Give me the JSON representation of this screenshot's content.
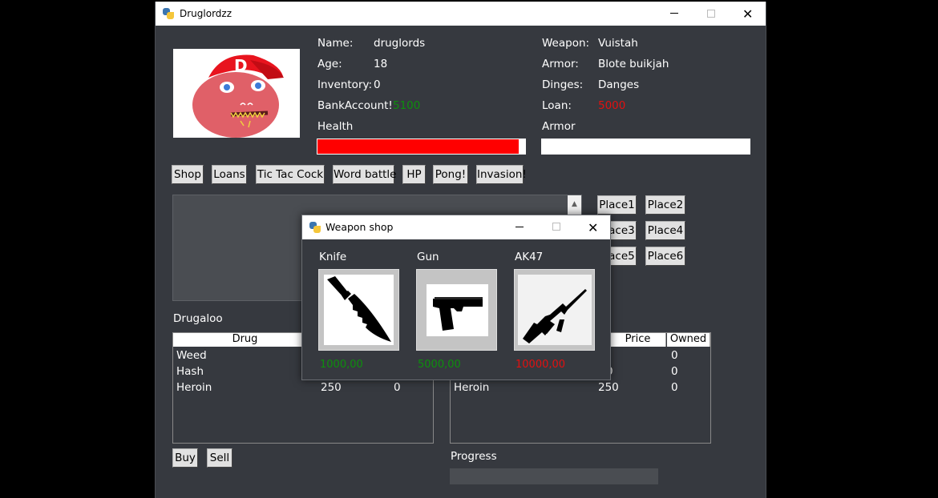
{
  "window": {
    "title": "Druglordzz"
  },
  "player": {
    "name_label": "Name:",
    "name": "druglords",
    "age_label": "Age:",
    "age": "18",
    "inventory_label": "Inventory:",
    "inventory": "0",
    "bank_label": "BankAccount!",
    "bank": "5100",
    "health_label": "Health",
    "health_fraction": 0.97
  },
  "equipment": {
    "weapon_label": "Weapon:",
    "weapon": "Vuistah",
    "armor_label": "Armor:",
    "armor": "Blote buikjah",
    "dinges_label": "Dinges:",
    "dinges": "Danges",
    "loan_label": "Loan:",
    "loan": "5000",
    "armor_bar_label": "Armor"
  },
  "actions": [
    "Shop",
    "Loans",
    "Tic Tac Cock",
    "Word battle",
    "HP",
    "Pong!",
    "Invasion!"
  ],
  "places": [
    "Place1",
    "Place2",
    "Place3",
    "Place4",
    "Place5",
    "Place6"
  ],
  "left_table": {
    "title": "Drugaloo",
    "headers": [
      "Drug"
    ],
    "rows": [
      [
        "Weed",
        "",
        ""
      ],
      [
        "Hash",
        "",
        ""
      ],
      [
        "Heroin",
        "250",
        "0"
      ]
    ]
  },
  "right_table": {
    "headers": [
      "Price",
      "Owned"
    ],
    "rows": [
      [
        "",
        "",
        "0"
      ],
      [
        "",
        "0",
        "0"
      ],
      [
        "Heroin",
        "250",
        "0"
      ]
    ]
  },
  "buy_label": "Buy",
  "sell_label": "Sell",
  "progress_label": "Progress",
  "weapon_shop": {
    "title": "Weapon shop",
    "items": [
      {
        "name": "Knife",
        "price": "1000,00",
        "price_color": "#0d8f0d",
        "icon": "knife-icon"
      },
      {
        "name": "Gun",
        "price": "5000,00",
        "price_color": "#0d8f0d",
        "icon": "pistol-icon"
      },
      {
        "name": "AK47",
        "price": "10000,00",
        "price_color": "#e21010",
        "icon": "rifle-icon"
      }
    ]
  },
  "colors": {
    "background": "#36393f",
    "health": "#ff0000",
    "positive": "#0d8f0d",
    "negative": "#e21010"
  }
}
